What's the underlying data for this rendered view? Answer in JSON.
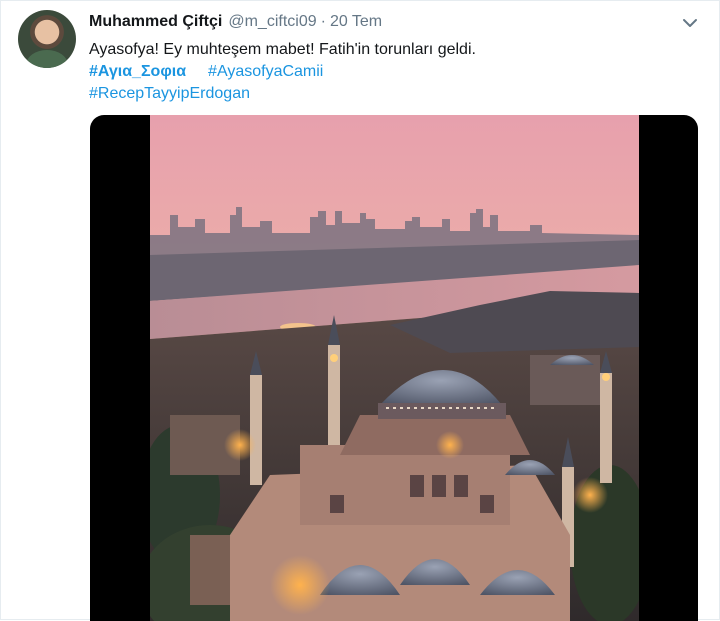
{
  "tweet": {
    "author_name": "Muhammed Çiftçi",
    "handle": "@m_ciftci09",
    "separator": "·",
    "date": "20 Tem",
    "text": "Ayasofya! Ey muhteşem mabet! Fatih'in torunları geldi.",
    "hashtags": [
      "#Αγια_Σοφια",
      "#AyasofyaCamii",
      "#RecepTayyipErdogan"
    ]
  },
  "icons": {
    "caret": "chevron-down-icon",
    "avatar": "profile-avatar"
  },
  "colors": {
    "link": "#1b95e0",
    "name": "#14171a",
    "muted": "#657786",
    "media_bg": "#000000"
  }
}
